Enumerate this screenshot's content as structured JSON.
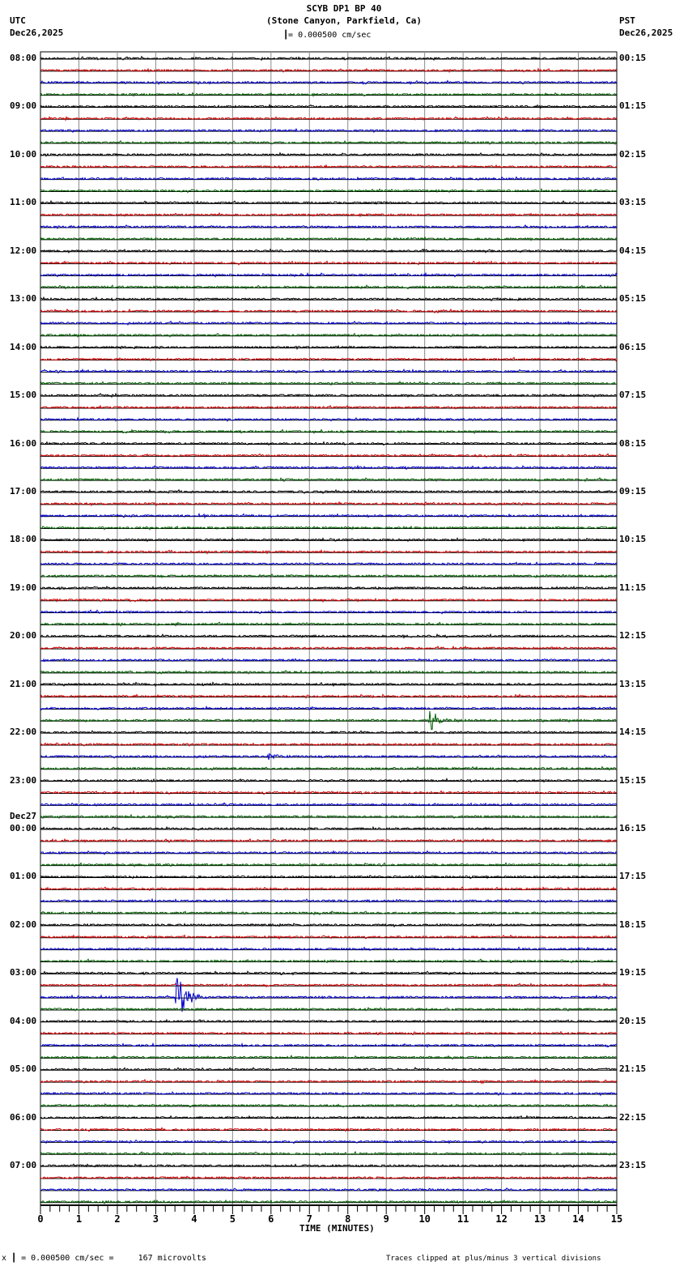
{
  "header": {
    "title": "SCYB DP1 BP 40",
    "subtitle": "(Stone Canyon, Parkfield, Ca)",
    "left_tz": "UTC",
    "left_date": "Dec26,2025",
    "right_tz": "PST",
    "right_date": "Dec26,2025",
    "scale": "= 0.000500 cm/sec"
  },
  "footer": {
    "scale_prefix": "x",
    "scale": "= 0.000500 cm/sec =     167 microvolts",
    "clip_note": "Traces clipped at plus/minus 3 vertical divisions"
  },
  "chart_data": {
    "type": "line",
    "title": "SCYB DP1 BP 40",
    "xlabel": "TIME (MINUTES)",
    "xlim": [
      0,
      15
    ],
    "xticks": [
      "0",
      "1",
      "2",
      "3",
      "4",
      "5",
      "6",
      "7",
      "8",
      "9",
      "10",
      "11",
      "12",
      "13",
      "14",
      "15"
    ],
    "rows_per_hour": 4,
    "trace_colors": [
      "#000000",
      "#d00000",
      "#0000d0",
      "#006000"
    ],
    "utc_labels": [
      "08:00",
      "09:00",
      "10:00",
      "11:00",
      "12:00",
      "13:00",
      "14:00",
      "15:00",
      "16:00",
      "17:00",
      "18:00",
      "19:00",
      "20:00",
      "21:00",
      "22:00",
      "23:00",
      "00:00",
      "01:00",
      "02:00",
      "03:00",
      "04:00",
      "05:00",
      "06:00",
      "07:00"
    ],
    "date_change": {
      "label": "Dec27",
      "hour_index": 16
    },
    "pst_labels": [
      "00:15",
      "01:15",
      "02:15",
      "03:15",
      "04:15",
      "05:15",
      "06:15",
      "07:15",
      "08:15",
      "09:15",
      "10:15",
      "11:15",
      "12:15",
      "13:15",
      "14:15",
      "15:15",
      "16:15",
      "17:15",
      "18:15",
      "19:15",
      "20:15",
      "21:15",
      "22:15",
      "23:15"
    ],
    "events": [
      {
        "row": 15,
        "minute": 10.5,
        "duration": 0.4,
        "amplitude": 0.1
      },
      {
        "row": 18,
        "minute": 10.0,
        "duration": 1.0,
        "amplitude": 0.12
      },
      {
        "row": 55,
        "minute": 10.1,
        "duration": 1.0,
        "amplitude": 1.2
      },
      {
        "row": 58,
        "minute": 5.9,
        "duration": 0.8,
        "amplitude": 0.45
      },
      {
        "row": 73,
        "minute": 13.4,
        "duration": 0.5,
        "amplitude": 0.12
      },
      {
        "row": 78,
        "minute": 3.5,
        "duration": 1.0,
        "amplitude": 2.6
      }
    ]
  }
}
